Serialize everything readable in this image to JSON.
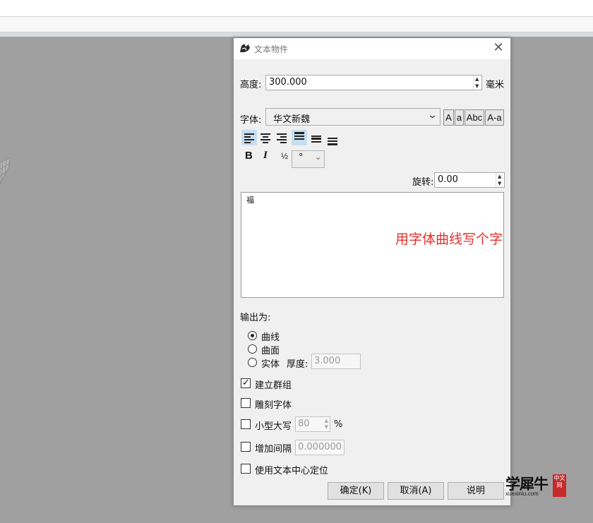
{
  "dialog": {
    "title": "文本物件",
    "close_glyph": "✕",
    "height": {
      "label": "高度:",
      "value": "300.000",
      "unit": "毫米"
    },
    "font": {
      "label": "字体:",
      "value": "华文新魏",
      "case_buttons": [
        "A",
        "a",
        "Abc",
        "A-a"
      ]
    },
    "format": {
      "bold": "B",
      "italic": "I",
      "fraction": "½",
      "symbol": "°"
    },
    "rotation": {
      "label": "旋转:",
      "value": "0.00"
    },
    "text_content": "福",
    "annotation": "用字体曲线写个字",
    "output": {
      "label": "输出为:",
      "options": [
        "曲线",
        "曲面",
        "实体"
      ],
      "selected": "曲线",
      "thickness_label": "厚度:",
      "thickness_value": "3.000"
    },
    "checkboxes": {
      "group": {
        "label": "建立群组",
        "checked": true
      },
      "engrave": {
        "label": "雕刻字体",
        "checked": false
      },
      "small_caps": {
        "label": "小型大写",
        "checked": false,
        "value": "80",
        "unit": "%"
      },
      "spacing": {
        "label": "增加间隔",
        "checked": false,
        "value": "0.000000"
      },
      "center": {
        "label": "使用文本中心定位",
        "checked": false
      }
    },
    "buttons": {
      "ok": "确定(K)",
      "cancel": "取消(A)",
      "help": "说明"
    }
  },
  "watermark": {
    "title": "学犀牛",
    "site": "xuexiniu.com",
    "seal": "中文网"
  },
  "colors": {
    "annotation": "#e4322b",
    "selection": "#c5def0",
    "viewport": "#a0a0a0"
  }
}
